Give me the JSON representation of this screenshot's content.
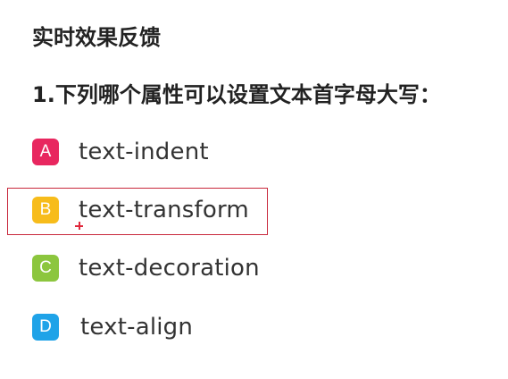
{
  "section_title": "实时效果反馈",
  "question": "1.下列哪个属性可以设置文本首字母大写：",
  "options": [
    {
      "letter": "A",
      "text": "text-indent",
      "color": "#e8275f"
    },
    {
      "letter": "B",
      "text": "text-transform",
      "color": "#f7bc1b"
    },
    {
      "letter": "C",
      "text": "text-decoration",
      "color": "#8cc63e"
    },
    {
      "letter": "D",
      "text": "text-align",
      "color": "#1fa3e8"
    }
  ],
  "highlight_color": "#c8283c",
  "selected_option": "B"
}
